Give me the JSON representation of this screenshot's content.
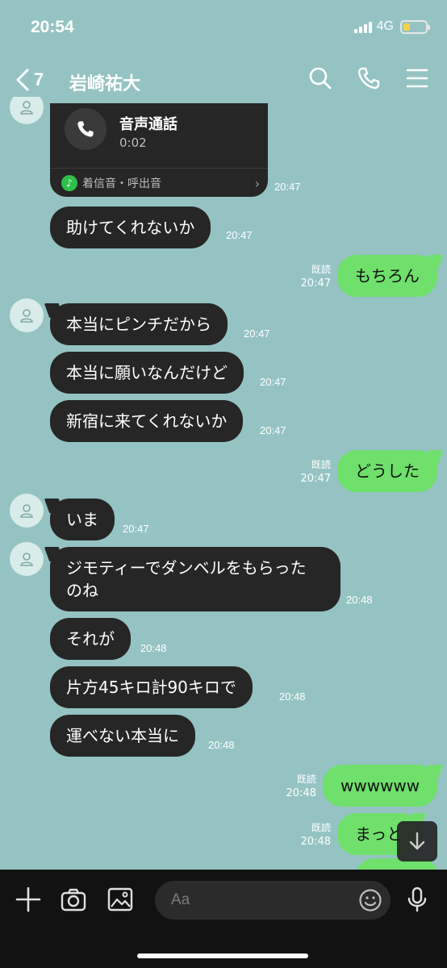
{
  "status": {
    "time": "20:54",
    "network": "4G",
    "battery_level": 0.3
  },
  "nav": {
    "back_count": "7",
    "title": "岩崎祐大"
  },
  "call_card": {
    "title": "音声通話",
    "duration": "0:02",
    "footer": "着信音・呼出音",
    "time": "20:47"
  },
  "messages": [
    {
      "side": "left",
      "text": "助けてくれないか",
      "time": "20:47"
    },
    {
      "side": "right",
      "text": "もちろん",
      "read": "既読",
      "time": "20:47"
    },
    {
      "side": "left",
      "text": "本当にピンチだから",
      "time": "20:47"
    },
    {
      "side": "left",
      "text": "本当に願いなんだけど",
      "time": "20:47"
    },
    {
      "side": "left",
      "text": "新宿に来てくれないか",
      "time": "20:47"
    },
    {
      "side": "right",
      "text": "どうした",
      "read": "既読",
      "time": "20:47"
    },
    {
      "side": "left",
      "text": "いま",
      "time": "20:47"
    },
    {
      "side": "left",
      "text_line1": "ジモティーでダンベルをもらった",
      "text_line2": "のね",
      "time": "20:48"
    },
    {
      "side": "left",
      "text": "それが",
      "time": "20:48"
    },
    {
      "side": "left",
      "text": "片方45キロ計90キロで",
      "time": "20:48"
    },
    {
      "side": "left",
      "text": "運べない本当に",
      "time": "20:48"
    },
    {
      "side": "right",
      "text": "wwwwww",
      "read": "既読",
      "time": "20:48"
    },
    {
      "side": "right",
      "text": "まっと",
      "read": "既読",
      "time": "20:48"
    }
  ],
  "composer": {
    "placeholder": "Aa"
  },
  "icons": {
    "back": "chevron-left-icon",
    "search": "search-icon",
    "call": "phone-icon",
    "menu": "menu-icon",
    "plus": "plus-icon",
    "camera": "camera-icon",
    "image": "image-icon",
    "emoji": "emoji-icon",
    "mic": "microphone-icon",
    "scroll": "arrow-down-icon"
  },
  "colors": {
    "background": "#95c3c3",
    "bubble_left": "#262626",
    "bubble_right": "#6fe06b",
    "bottom_bar": "#121212"
  }
}
